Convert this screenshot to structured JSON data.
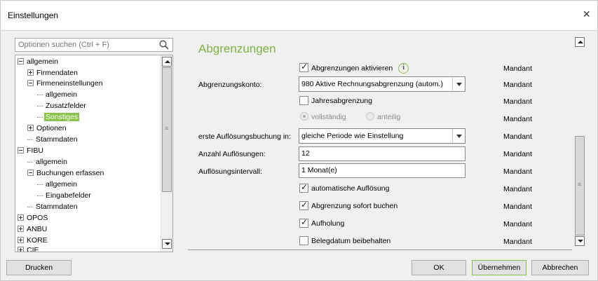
{
  "window": {
    "title": "Einstellungen",
    "close_glyph": "×"
  },
  "search": {
    "placeholder": "Optionen suchen (Ctrl + F)",
    "icon": "search-icon"
  },
  "tree": {
    "items": [
      {
        "label": "allgemein"
      },
      {
        "label": "Firmendaten"
      },
      {
        "label": "Firmeneinstellungen"
      },
      {
        "label": "allgemein"
      },
      {
        "label": "Zusatzfelder"
      },
      {
        "label": "Sonstiges"
      },
      {
        "label": "Optionen"
      },
      {
        "label": "Stammdaten"
      },
      {
        "label": "FIBU"
      },
      {
        "label": "allgemein"
      },
      {
        "label": "Buchungen erfassen"
      },
      {
        "label": "allgemein"
      },
      {
        "label": "Eingabefelder"
      },
      {
        "label": "Stammdaten"
      },
      {
        "label": "OPOS"
      },
      {
        "label": "ANBU"
      },
      {
        "label": "KORE"
      },
      {
        "label": "CIE"
      }
    ],
    "selected": "Sonstiges"
  },
  "section": {
    "title": "Abgrenzungen"
  },
  "form": {
    "abgrenzungen_aktivieren": {
      "label": "Abgrenzungen aktivieren",
      "checked": true,
      "scope": "Mandant"
    },
    "abgrenzungskonto": {
      "label": "Abgrenzungskonto:",
      "value": "980 Aktive Rechnungsabgrenzung (autom.)",
      "scope": "Mandant"
    },
    "jahresabgrenzung": {
      "label": "Jahresabgrenzung",
      "checked": false,
      "scope": "Mandant"
    },
    "mode": {
      "option1": "vollständig",
      "option2": "anteilig",
      "selected": "vollständig",
      "scope": "Mandant"
    },
    "erste_aufloesung": {
      "label": "erste Auflösungsbuchung in:",
      "value": "gleiche Periode wie Einstellung",
      "scope": "Mandant"
    },
    "anzahl": {
      "label": "Anzahl Auflösungen:",
      "value": "12",
      "scope": "Mandant"
    },
    "intervall": {
      "label": "Auflösungsintervall:",
      "value": "1 Monat(e)",
      "scope": "Mandant"
    },
    "automatische": {
      "label": "automatische Auflösung",
      "checked": true,
      "scope": "Mandant"
    },
    "sofort": {
      "label": "Abgrenzung sofort buchen",
      "checked": true,
      "scope": "Mandant"
    },
    "aufholung": {
      "label": "Aufholung",
      "checked": true,
      "scope": "Mandant"
    },
    "belegdatum": {
      "label": "Belegdatum beibehalten",
      "checked": false,
      "scope": "Mandant"
    }
  },
  "buttons": {
    "print": "Drucken",
    "ok": "OK",
    "apply": "Übernehmen",
    "cancel": "Abbrechen"
  },
  "colors": {
    "accent": "#8bc34a",
    "section_title": "#7cb342"
  }
}
